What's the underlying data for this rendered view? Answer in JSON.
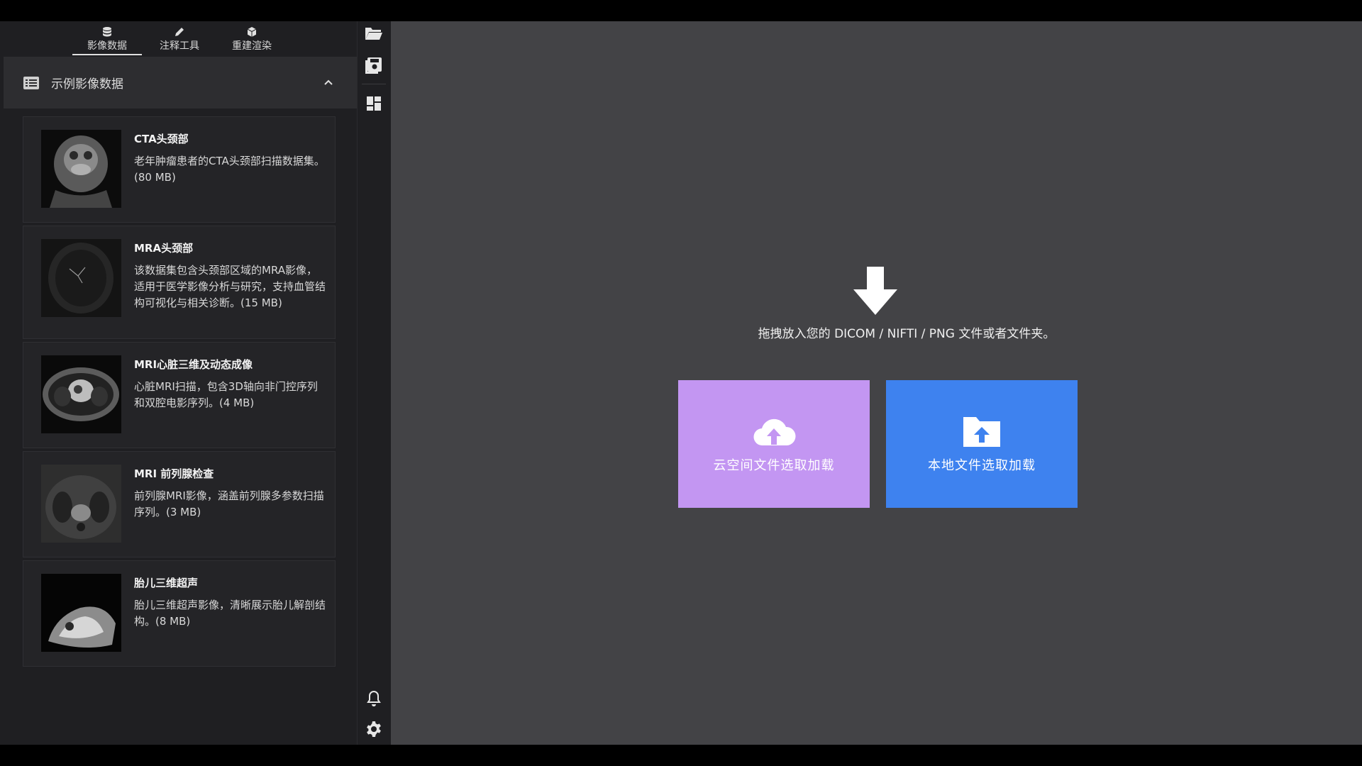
{
  "tabs": [
    {
      "label": "影像数据",
      "icon": "database-icon",
      "active": true
    },
    {
      "label": "注释工具",
      "icon": "pencil-icon",
      "active": false
    },
    {
      "label": "重建渲染",
      "icon": "cube-icon",
      "active": false
    }
  ],
  "panel": {
    "title": "示例影像数据",
    "icon": "list-icon",
    "expanded": true
  },
  "datasets": [
    {
      "title": "CTA头颈部",
      "desc": "老年肿瘤患者的CTA头颈部扫描数据集。(80 MB)"
    },
    {
      "title": "MRA头颈部",
      "desc": "该数据集包含头颈部区域的MRA影像，适用于医学影像分析与研究，支持血管结构可视化与相关诊断。(15 MB)"
    },
    {
      "title": "MRI心脏三维及动态成像",
      "desc": "心脏MRI扫描，包含3D轴向非门控序列和双腔电影序列。(4 MB)"
    },
    {
      "title": "MRI 前列腺检查",
      "desc": "前列腺MRI影像，涵盖前列腺多参数扫描序列。(3 MB)"
    },
    {
      "title": "胎儿三维超声",
      "desc": "胎儿三维超声影像，清晰展示胎儿解剖结构。(8 MB)"
    }
  ],
  "toolbar": {
    "icons": [
      "folder-open-icon",
      "save-icon",
      "layout-icon",
      "bell-icon",
      "settings-icon"
    ]
  },
  "main": {
    "drop_text": "拖拽放入您的 DICOM / NIFTI / PNG 文件或者文件夹。",
    "cloud_button": "云空间文件选取加载",
    "local_button": "本地文件选取加载"
  },
  "colors": {
    "cloud_button": "#c396f2",
    "local_button": "#3e82ef",
    "main_bg": "#434346",
    "sidebar_bg": "#1f1f22"
  }
}
